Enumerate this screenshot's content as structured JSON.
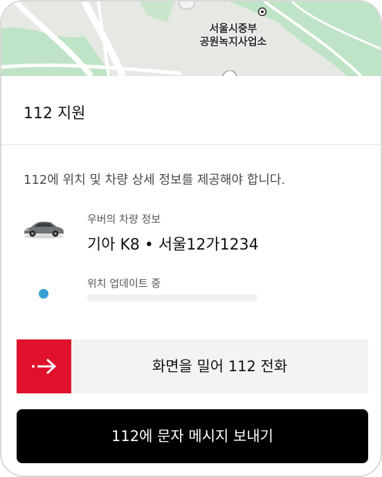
{
  "map": {
    "label_line1": "서울시중부",
    "label_line2": "공원녹지사업소",
    "colors": {
      "land": "#e6e8e4",
      "park": "#bfe3c6",
      "road": "#ffffff"
    }
  },
  "sheet": {
    "title": "112 지원",
    "description": "112에 위치 및 차량 상세 정보를 제공해야 합니다."
  },
  "vehicle": {
    "caption": "우버의 차량 정보",
    "value": "기아 K8 • 서울12가1234",
    "icon": "car-icon"
  },
  "location": {
    "caption": "위치 업데이트 중",
    "icon": "location-dot-icon",
    "dot_color": "#3aa0d2"
  },
  "actions": {
    "swipe_label": "화면을 밀어 112 전화",
    "swipe_icon": "arrow-right-icon",
    "swipe_color": "#e0112b",
    "sms_label": "112에 문자 메시지 보내기"
  }
}
